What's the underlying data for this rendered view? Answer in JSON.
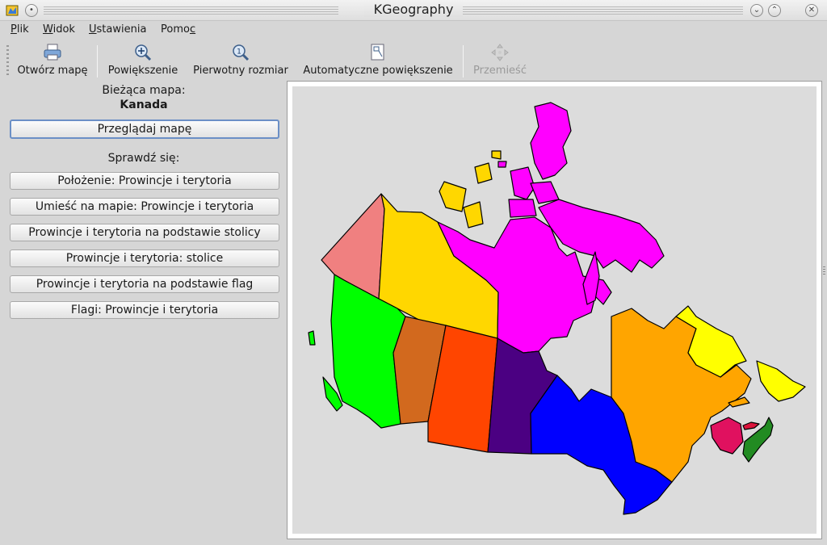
{
  "window": {
    "title": "KGeography"
  },
  "menu": {
    "file": {
      "label": "Plik",
      "mnemonic": "P",
      "rest": "lik"
    },
    "view": {
      "label": "Widok",
      "mnemonic": "W",
      "rest": "idok"
    },
    "settings": {
      "label": "Ustawienia",
      "mnemonic": "U",
      "rest": "stawienia"
    },
    "help": {
      "label": "Pomoc",
      "pre": "Pomo",
      "mnemonic": "c"
    }
  },
  "toolbar": {
    "open_map": "Otwórz mapę",
    "zoom": "Powiększenie",
    "original_size": "Pierwotny rozmiar",
    "auto_zoom": "Automatyczne powiększenie",
    "move": "Przemieść"
  },
  "panel": {
    "current_map_label": "Bieżąca mapa:",
    "current_map_name": "Kanada",
    "browse_button": "Przeglądaj mapę",
    "quiz_label": "Sprawdź się:",
    "quiz_buttons": [
      "Położenie: Prowincje i terytoria",
      "Umieść na mapie: Prowincje i terytoria",
      "Prowincje i terytoria na podstawie stolicy",
      "Prowincje i terytoria: stolice",
      "Prowincje i terytoria na podstawie flag",
      "Flagi: Prowincje i terytoria"
    ]
  },
  "map": {
    "colors": {
      "yukon": "#f08080",
      "northwest_territories": "#ffd700",
      "nunavut": "#ff00ff",
      "british_columbia": "#00ff00",
      "alberta": "#d2691e",
      "saskatchewan": "#ff4500",
      "manitoba": "#4b0082",
      "ontario": "#0000ff",
      "quebec": "#ffa500",
      "newfoundland_labrador": "#ffff00",
      "new_brunswick": "#e0115f",
      "nova_scotia": "#228b22",
      "prince_edward_island": "#dc143c",
      "water": "#dcdcdc"
    }
  }
}
